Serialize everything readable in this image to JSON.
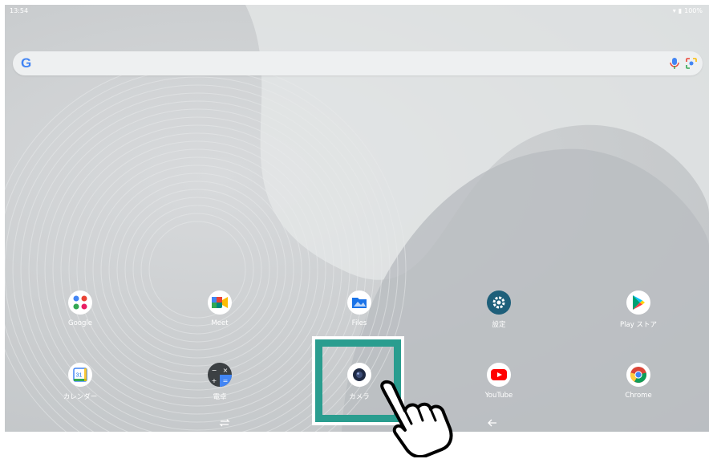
{
  "status": {
    "time": "13:54",
    "battery": "100%"
  },
  "search": {
    "logo": "G"
  },
  "apps_row1": [
    {
      "label": "Google",
      "icon": "google-folder-icon"
    },
    {
      "label": "Meet",
      "icon": "meet-icon"
    },
    {
      "label": "Files",
      "icon": "files-icon"
    },
    {
      "label": "設定",
      "icon": "settings-gear-icon"
    },
    {
      "label": "Play ストア",
      "icon": "play-store-icon"
    }
  ],
  "apps_row2": [
    {
      "label": "カレンダー",
      "icon": "calendar-icon",
      "badge": "31"
    },
    {
      "label": "電卓",
      "icon": "calculator-icon"
    },
    {
      "label": "カメラ",
      "icon": "camera-icon"
    },
    {
      "label": "YouTube",
      "icon": "youtube-icon"
    },
    {
      "label": "Chrome",
      "icon": "chrome-icon"
    }
  ],
  "colors": {
    "highlight": "#2a9d8f",
    "accent_blue": "#1a73e8"
  }
}
